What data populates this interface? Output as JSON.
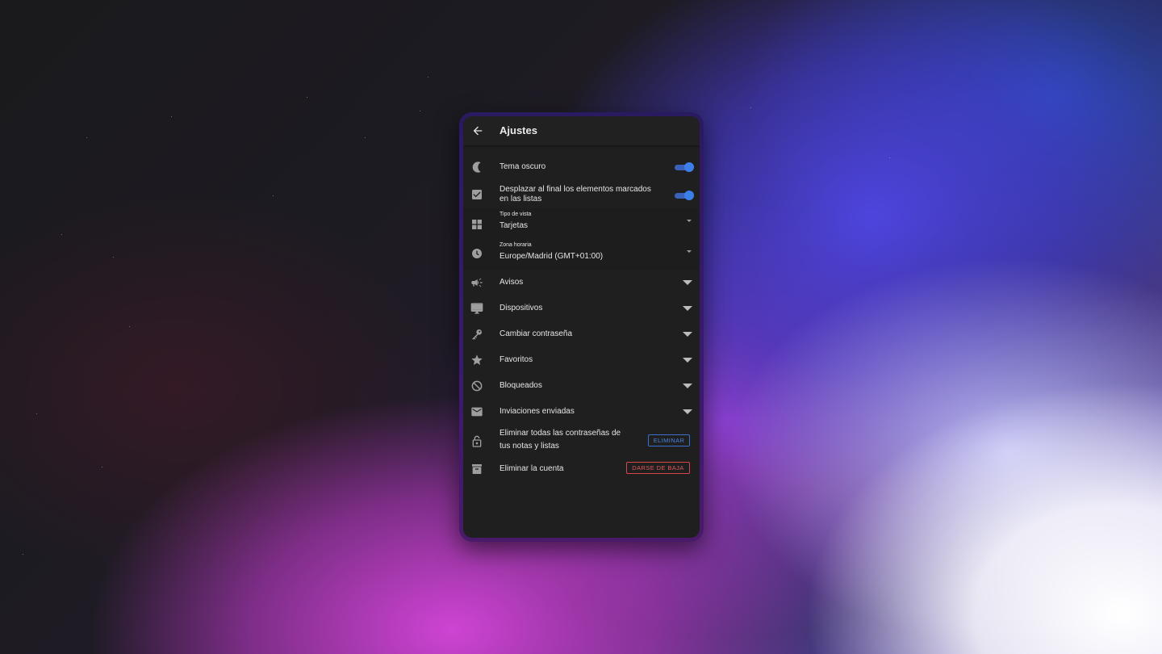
{
  "header": {
    "title": "Ajustes",
    "back_icon": "arrow-left-icon"
  },
  "settings": {
    "dark_theme": {
      "label": "Tema oscuro",
      "icon": "moon-icon",
      "enabled": true
    },
    "move_checked": {
      "label_line1": "Desplazar al final los elementos marcados",
      "label_line2": "en las listas",
      "icon": "checkbox-icon",
      "enabled": true
    },
    "view_type": {
      "caption": "Tipo de vista",
      "value": "Tarjetas",
      "icon": "grid-icon"
    },
    "timezone": {
      "caption": "Zona horaria",
      "value": "Europe/Madrid (GMT+01:00)",
      "icon": "clock-icon"
    }
  },
  "sections": [
    {
      "label": "Avisos",
      "icon": "megaphone-icon"
    },
    {
      "label": "Dispositivos",
      "icon": "monitor-icon"
    },
    {
      "label": "Cambiar contraseña",
      "icon": "key-icon"
    },
    {
      "label": "Favoritos",
      "icon": "star-icon"
    },
    {
      "label": "Bloqueados",
      "icon": "block-icon"
    },
    {
      "label": "Inviaciones enviadas",
      "icon": "mail-icon"
    }
  ],
  "actions": {
    "remove_passwords": {
      "label_line1": "Eliminar todas las contraseñas de",
      "label_line2": "tus notas y listas",
      "button": "ELIMINAR",
      "icon": "unlock-icon"
    },
    "delete_account": {
      "label": "Eliminar la cuenta",
      "button": "DARSE DE BAJA",
      "icon": "archive-icon"
    }
  },
  "colors": {
    "accent": "#3d7fe9",
    "danger": "#e05a5a",
    "surface": "#1f1f1f",
    "text": "#e6e6e6"
  }
}
